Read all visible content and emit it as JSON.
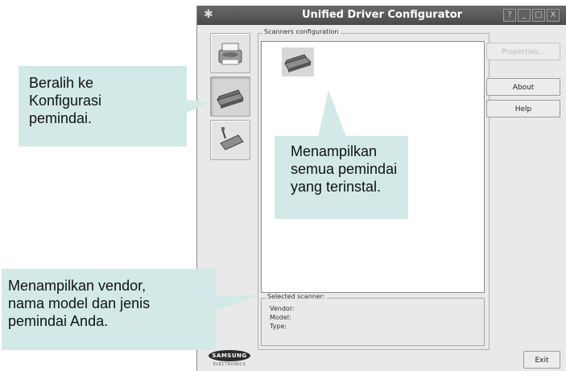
{
  "window": {
    "title": "Unified Driver Configurator",
    "controls": [
      "?",
      "_",
      "□",
      "X"
    ]
  },
  "nav": {
    "items": [
      {
        "name": "printers",
        "icon": "printer-icon",
        "active": false
      },
      {
        "name": "scanners",
        "icon": "scanner-icon",
        "active": true
      },
      {
        "name": "ports",
        "icon": "port-icon",
        "active": false
      }
    ]
  },
  "scanners": {
    "group_label": "Scanners configuration",
    "list_items": [
      {
        "icon": "scanner-icon"
      }
    ],
    "selected": {
      "title": "Selected scanner:",
      "vendor_label": "Vendor:",
      "model_label": "Model:",
      "type_label": "Type:"
    }
  },
  "buttons": {
    "properties": "Properties...",
    "about": "About",
    "help": "Help",
    "exit": "Exit"
  },
  "logo": {
    "brand": "SAMSUNG",
    "sub": "ELECTRONICS"
  },
  "callouts": {
    "switch": [
      "Beralih ke",
      "Konfigurasi",
      "pemindai."
    ],
    "list": [
      "Menampilkan",
      "semua pemindai",
      "yang terinstal."
    ],
    "info": [
      "Menampilkan vendor,",
      "nama model dan jenis",
      "pemindai Anda."
    ]
  },
  "colors": {
    "callout_bg": "#d3e9e8",
    "titlebar": "#555555"
  }
}
